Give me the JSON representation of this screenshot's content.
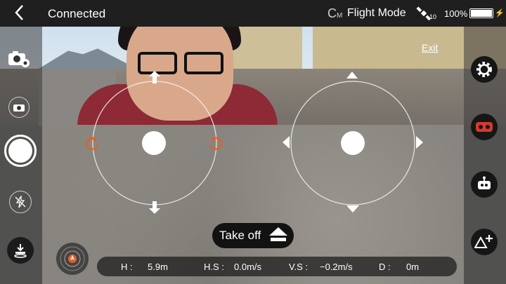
{
  "topbar": {
    "back_icon": "chevron-left-icon",
    "connection_status": "Connected",
    "mode_prefix": "C",
    "mode_sub": "M",
    "flight_mode": "Flight Mode",
    "satellite_icon": "satellite-icon",
    "satellite_count": "10",
    "battery_percent": "100%",
    "battery_level": 1.0
  },
  "left_controls": {
    "photo_settings_icon": "camera-settings-icon",
    "switch_camera_icon": "camera-switch-icon",
    "shutter_icon": "shutter-button-icon",
    "flash_icon": "flash-off-icon",
    "land_icon": "landing-icon",
    "compass_icon": "compass-icon"
  },
  "right_controls": {
    "exit_label": "Exit",
    "settings_icon": "gear-icon",
    "vr_icon": "vr-headset-icon",
    "robot_icon": "robot-icon",
    "waypoint_icon": "add-shape-icon"
  },
  "takeoff": {
    "label": "Take off"
  },
  "telemetry": {
    "height_label": "H :",
    "height_value": "5.9m",
    "hspeed_label": "H.S :",
    "hspeed_value": "0.0m/s",
    "vspeed_label": "V.S :",
    "vspeed_value": "−0.2m/s",
    "distance_label": "D :",
    "distance_value": "0m"
  },
  "colors": {
    "accent_orange": "#e0622a",
    "vr_red": "#d33a2c",
    "bar_bg": "#1f1f1f"
  }
}
